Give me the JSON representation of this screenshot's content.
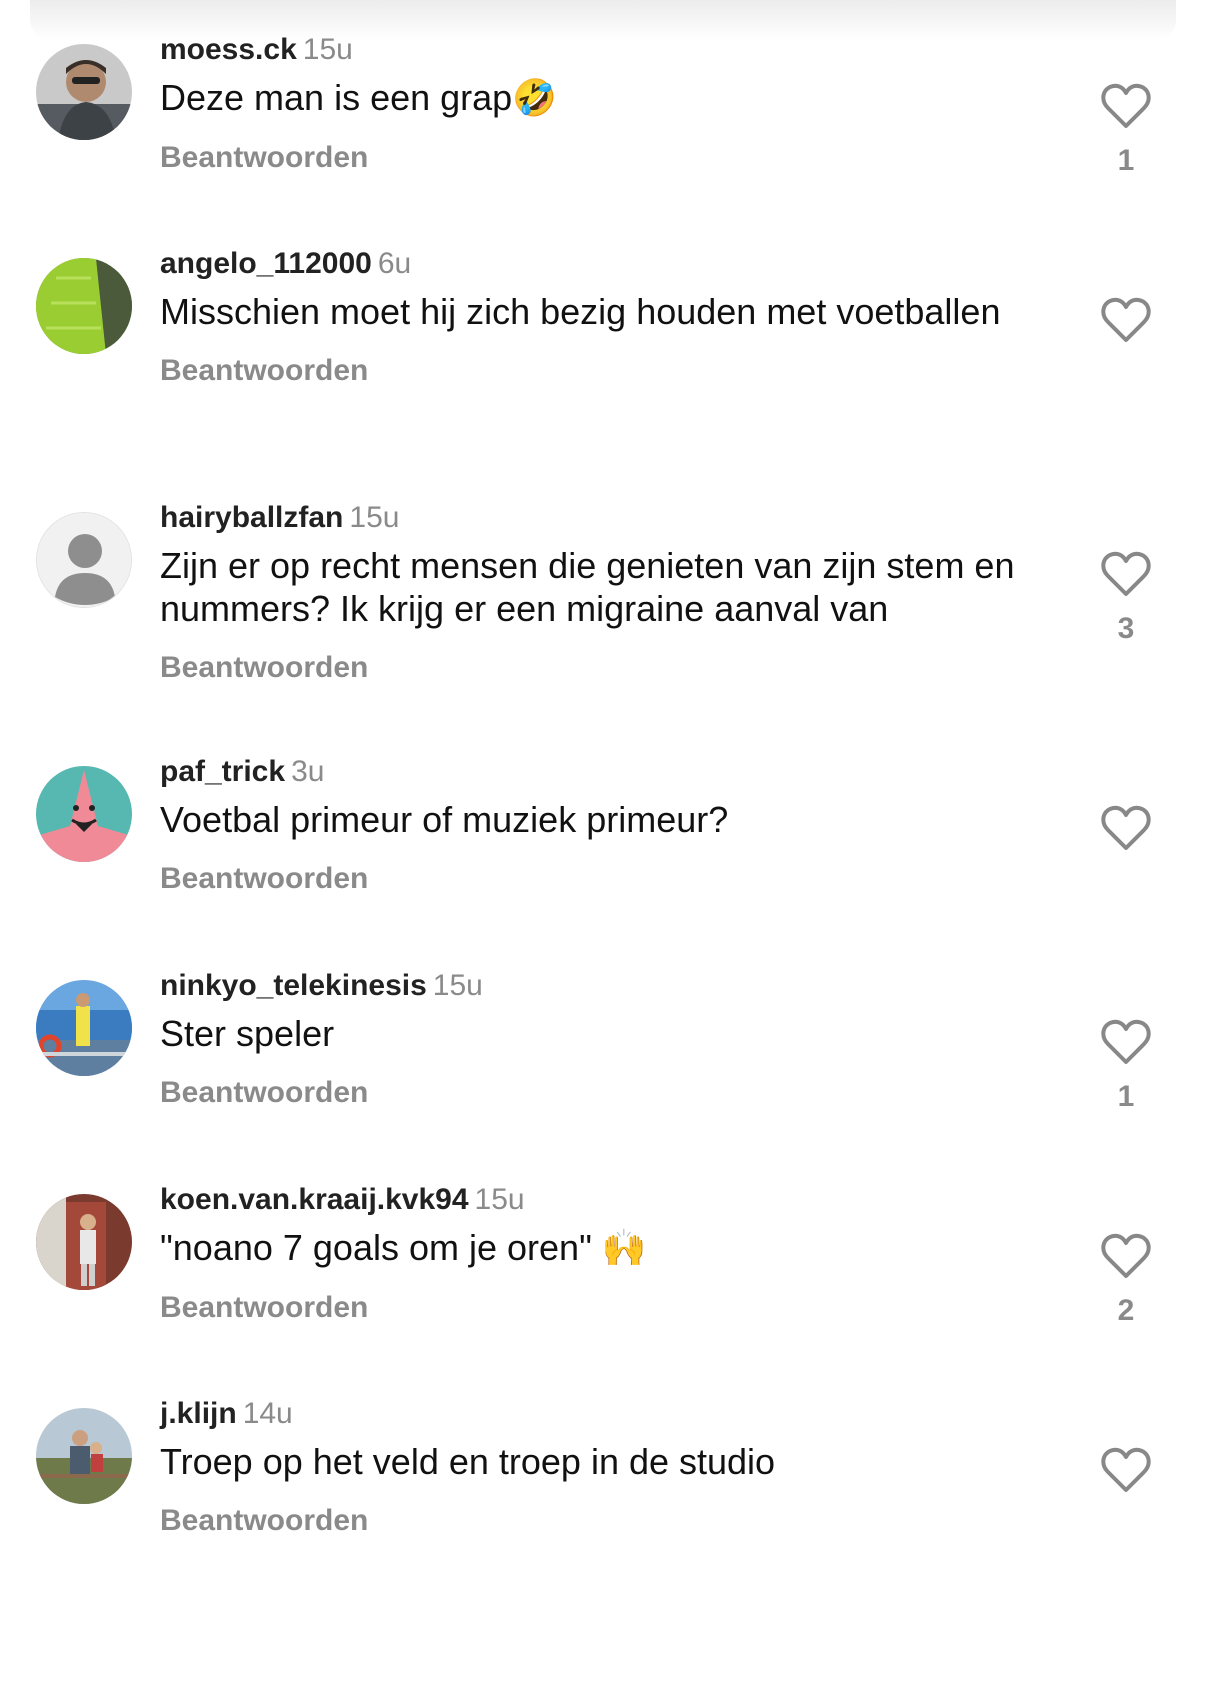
{
  "reply_label": "Beantwoorden",
  "colors": {
    "username": "#222222",
    "secondary": "#8a8a8a",
    "text": "#111111",
    "heart_outline": "#888888"
  },
  "comments": [
    {
      "username": "moess.ck",
      "time": "15u",
      "text": "Deze man is een grap",
      "emoji": "🤣",
      "likes": "1",
      "avatar_icon": "man-with-sunglasses-photo"
    },
    {
      "username": "angelo_112000",
      "time": "6u",
      "text": "Misschien moet hij zich bezig houden met voetballen",
      "emoji": "",
      "likes": "",
      "avatar_icon": "green-field-photo"
    },
    {
      "username": "hairyballzfan",
      "time": "15u",
      "text": "Zijn er op recht mensen die genieten van zijn stem en nummers? Ik krijg er een migraine aanval van",
      "emoji": "",
      "likes": "3",
      "avatar_icon": "default-user-icon"
    },
    {
      "username": "paf_trick",
      "time": "3u",
      "text": "Voetbal primeur of muziek primeur?",
      "emoji": "",
      "likes": "",
      "avatar_icon": "pink-starfish-cartoon"
    },
    {
      "username": "ninkyo_telekinesis",
      "time": "15u",
      "text": "Ster speler",
      "emoji": "",
      "likes": "1",
      "avatar_icon": "boat-deck-photo"
    },
    {
      "username": "koen.van.kraaij.kvk94",
      "time": "15u",
      "text": "\"noano 7 goals om je oren\" ",
      "emoji": "🙌",
      "likes": "2",
      "avatar_icon": "person-at-door-photo"
    },
    {
      "username": "j.klijn",
      "time": "14u",
      "text": "Troep op het veld en troep in de studio",
      "emoji": "",
      "likes": "",
      "avatar_icon": "person-outdoors-photo"
    }
  ]
}
